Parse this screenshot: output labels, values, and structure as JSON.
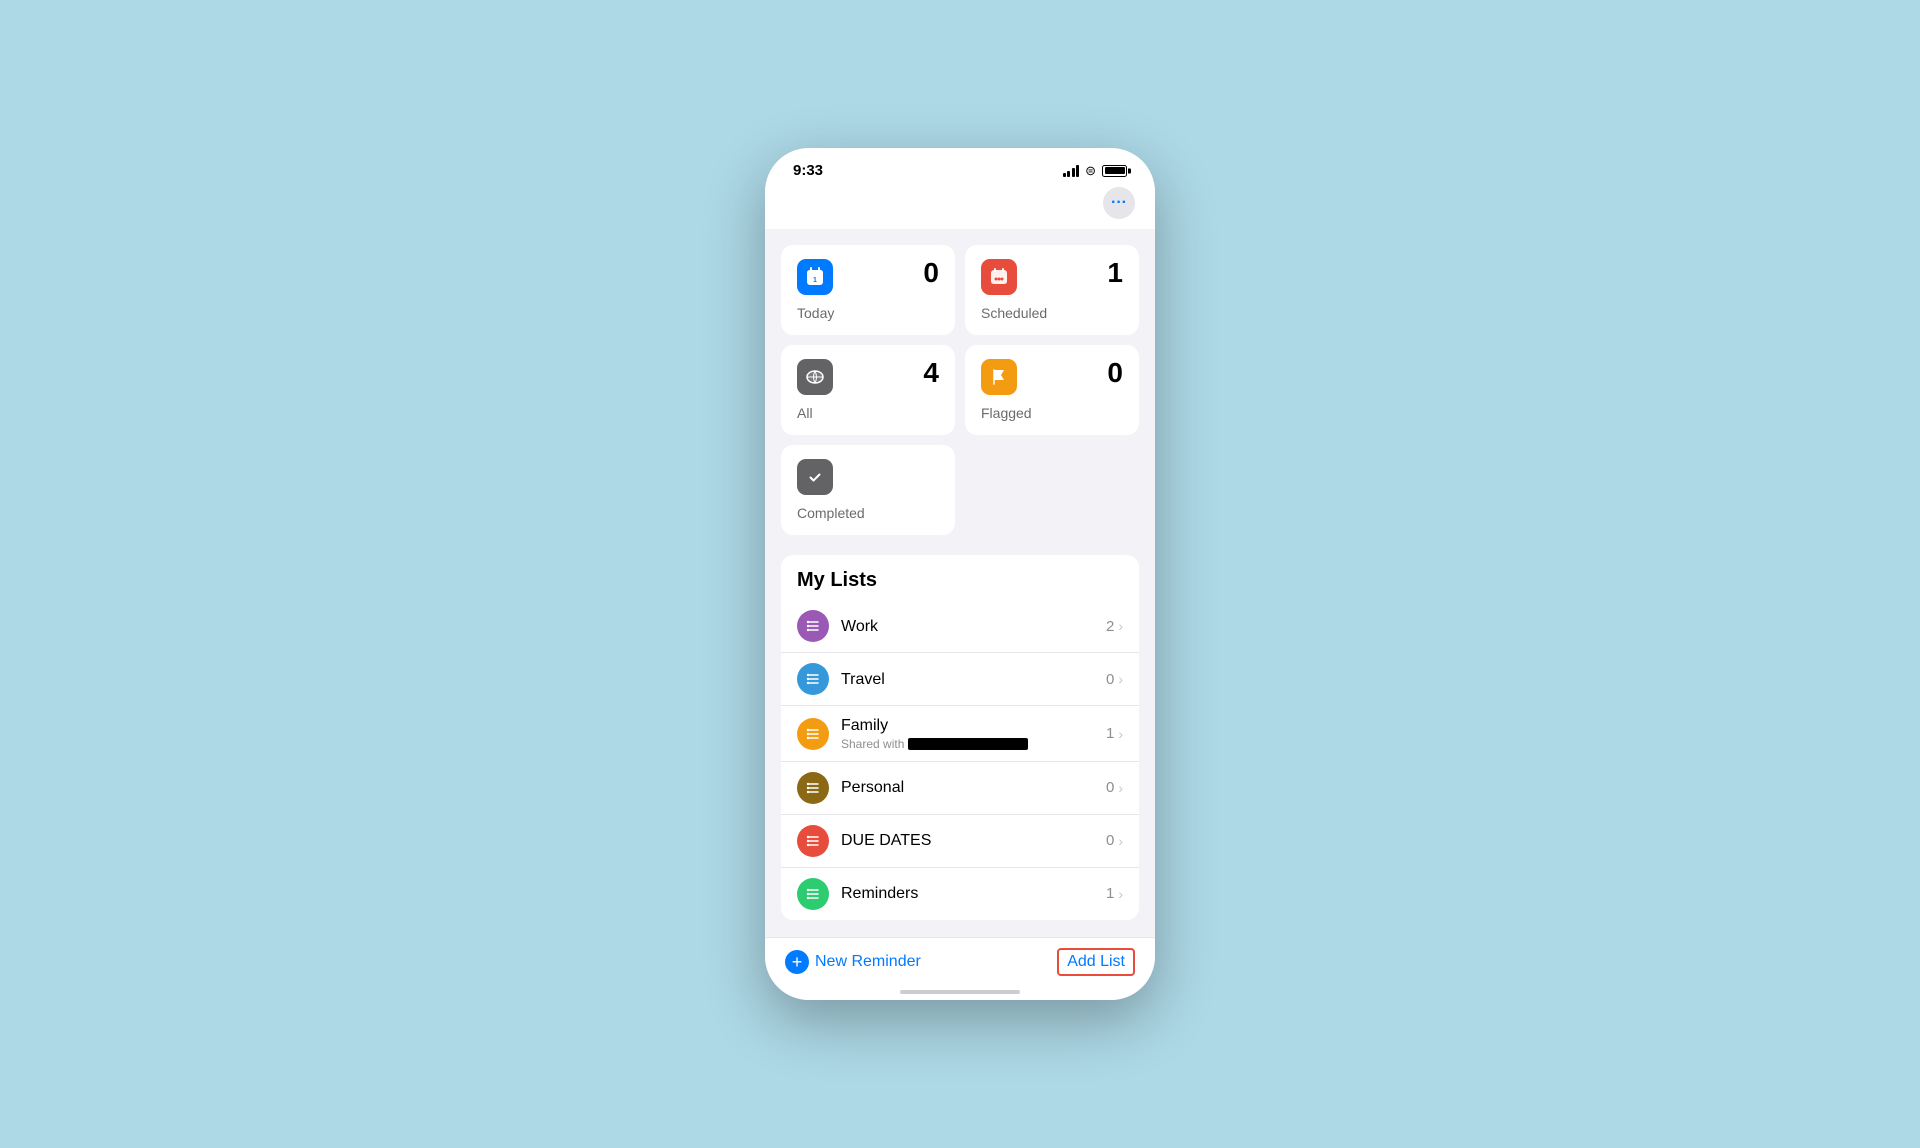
{
  "statusBar": {
    "time": "9:33"
  },
  "header": {
    "moreButtonLabel": "···"
  },
  "smartLists": [
    {
      "id": "today",
      "label": "Today",
      "count": "0",
      "iconColor": "#007aff",
      "iconSymbol": "📅"
    },
    {
      "id": "scheduled",
      "label": "Scheduled",
      "count": "1",
      "iconColor": "#e74c3c",
      "iconSymbol": "📆"
    },
    {
      "id": "all",
      "label": "All",
      "count": "4",
      "iconColor": "#1c1c1e",
      "iconSymbol": "☁"
    },
    {
      "id": "flagged",
      "label": "Flagged",
      "count": "0",
      "iconColor": "#f39c12",
      "iconSymbol": "🚩"
    },
    {
      "id": "completed",
      "label": "Completed",
      "count": "",
      "iconColor": "#636366",
      "iconSymbol": "✓",
      "single": true
    }
  ],
  "myLists": {
    "title": "My Lists",
    "items": [
      {
        "name": "Work",
        "count": "2",
        "iconColor": "#9b59b6",
        "subtitle": ""
      },
      {
        "name": "Travel",
        "count": "0",
        "iconColor": "#3498db",
        "subtitle": ""
      },
      {
        "name": "Family",
        "count": "1",
        "iconColor": "#f39c12",
        "subtitle": "Shared with",
        "sharedWith": true
      },
      {
        "name": "Personal",
        "count": "0",
        "iconColor": "#8b6914",
        "subtitle": ""
      },
      {
        "name": "DUE DATES",
        "count": "0",
        "iconColor": "#e74c3c",
        "subtitle": ""
      },
      {
        "name": "Reminders",
        "count": "1",
        "iconColor": "#2ecc71",
        "subtitle": ""
      }
    ]
  },
  "bottomBar": {
    "newReminderLabel": "New Reminder",
    "addListLabel": "Add List"
  }
}
